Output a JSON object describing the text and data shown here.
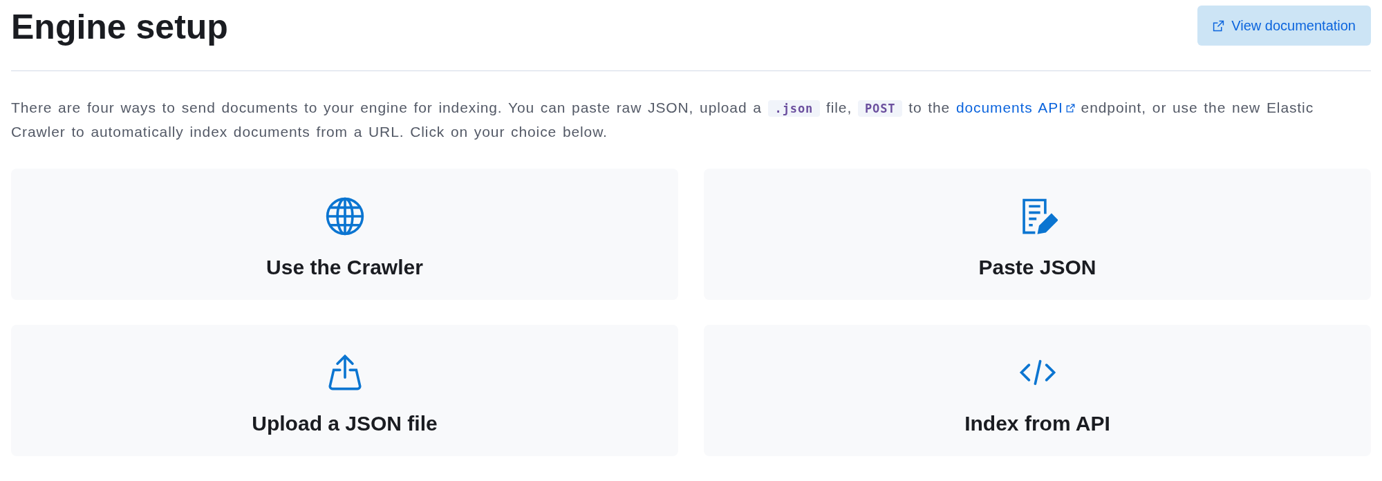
{
  "header": {
    "title": "Engine setup",
    "button": "View documentation"
  },
  "description": [
    {
      "kind": "text",
      "text": "There are four ways to send documents to your engine for indexing. You can paste raw JSON, upload a "
    },
    {
      "kind": "code",
      "text": ".json"
    },
    {
      "kind": "text",
      "text": " file, "
    },
    {
      "kind": "code",
      "text": "POST"
    },
    {
      "kind": "text",
      "text": " to the "
    },
    {
      "kind": "link",
      "text": "documents API"
    },
    {
      "kind": "text",
      "text": " endpoint, or use the new Elastic Crawler to automatically index documents from a URL. Click on your choice below."
    }
  ],
  "options": [
    {
      "kind": "globe",
      "label": "Use the Crawler"
    },
    {
      "kind": "document",
      "label": "Paste JSON"
    },
    {
      "kind": "upload",
      "label": "Upload a JSON file"
    },
    {
      "kind": "code",
      "label": "Index from API"
    }
  ]
}
